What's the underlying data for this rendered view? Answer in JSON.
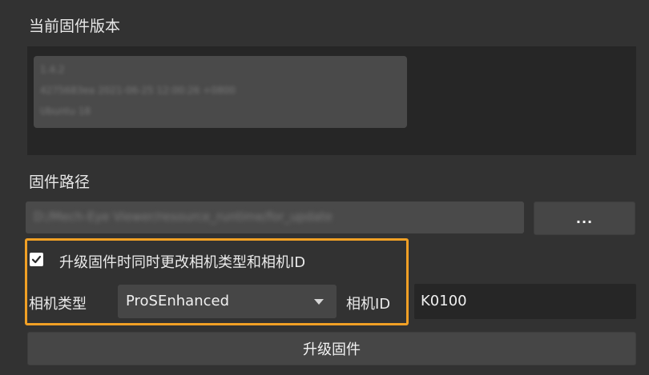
{
  "firmware": {
    "current_version_label": "当前固件版本",
    "version_lines": [
      "1.4.2",
      "4275683ea 2021-06-25 12:00:26 +0800",
      "Ubuntu 18"
    ]
  },
  "path": {
    "label": "固件路径",
    "value": "D:/Mech-Eye Viewer/resource_runtime/for_update",
    "browse_label": "..."
  },
  "options": {
    "change_type_checkbox_label": "升级固件时同时更改相机类型和相机ID",
    "checkbox_checked": true,
    "camera_type_label": "相机类型",
    "camera_type_value": "ProSEnhanced",
    "camera_id_label": "相机ID",
    "camera_id_value": "K0100"
  },
  "actions": {
    "upgrade_label": "升级固件"
  },
  "colors": {
    "highlight": "#f1a025",
    "panel": "#323232",
    "field_dark": "#262626",
    "control": "#464646"
  }
}
